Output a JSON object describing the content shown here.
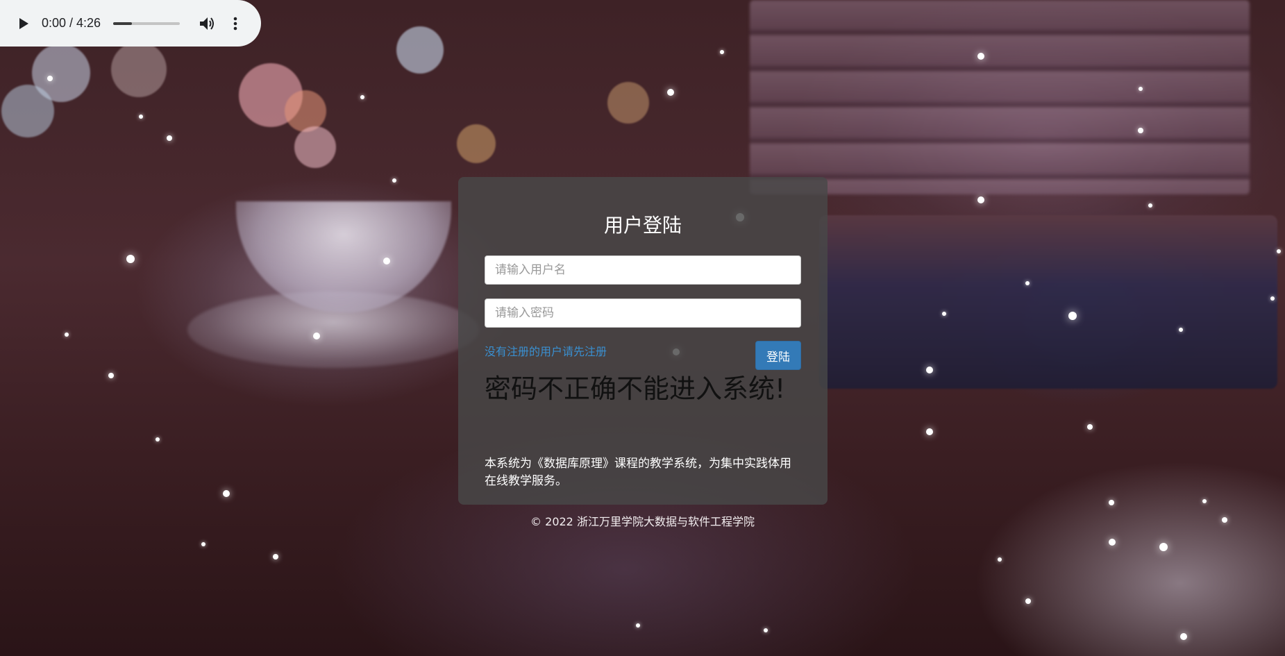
{
  "audio_player": {
    "time": "0:00 / 4:26",
    "progress": 0.28,
    "icons": {
      "play": "play-icon",
      "volume": "volume-icon",
      "more": "more-vert-icon"
    }
  },
  "login": {
    "title": "用户登陆",
    "username_placeholder": "请输入用户名",
    "password_placeholder": "请输入密码",
    "register_link": "没有注册的用户请先注册",
    "login_button": "登陆",
    "error_message": "密码不正确不能进入系统!",
    "intro": "本系统为《数据库原理》课程的教学系统，为集中实践体用在线教学服务。"
  },
  "footer": {
    "copyright": "© 2022 浙江万里学院大数据与软件工程学院"
  },
  "colors": {
    "panel_bg": "#484848",
    "button": "#337ab7",
    "link": "#3a8fd0",
    "player_bg": "#f1f3f4"
  }
}
